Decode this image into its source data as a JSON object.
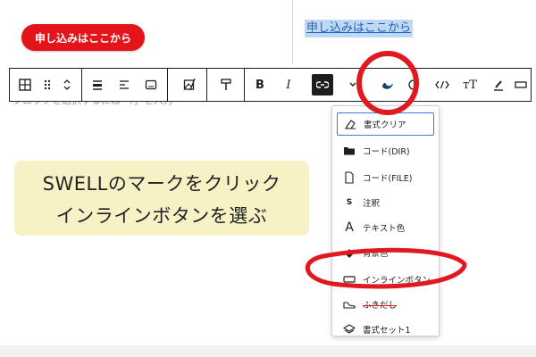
{
  "content": {
    "cta_button_label": "申し込みはここから",
    "link_text": "申し込みはここから",
    "ghost_text": "ブロックを選択するには「/」を入力"
  },
  "toolbar": {
    "items": [
      "table-icon",
      "drag-handle-icon",
      "move-up-down-icon",
      "align-icon",
      "text-align-icon",
      "block-icon",
      "image-icon",
      "bold",
      "italic",
      "link-icon",
      "more-chevron-icon",
      "swell-icon",
      "circle-icon",
      "code-icon",
      "font-size-icon",
      "highlight-icon",
      "box-icon"
    ],
    "bold_label": "B",
    "italic_label": "I",
    "font_size_label": "тT"
  },
  "annotation": {
    "line1": "SWELLのマークをクリック",
    "line2": "インラインボタンを選ぶ",
    "background_color": "#f7f1c5",
    "circle_color": "#e0181f"
  },
  "dropdown": {
    "items": [
      {
        "label": "書式クリア",
        "icon": "eraser-icon"
      },
      {
        "label": "コード(DIR)",
        "icon": "folder-icon"
      },
      {
        "label": "コード(FILE)",
        "icon": "file-icon"
      },
      {
        "label": "注釈",
        "icon": "s-icon"
      },
      {
        "label": "テキスト色",
        "icon": "text-a-icon"
      },
      {
        "label": "背景色",
        "icon": "paint-bucket-icon"
      },
      {
        "label": "インラインボタン",
        "icon": "inline-button-icon"
      },
      {
        "label": "ふきだし",
        "icon": "shoe-icon"
      },
      {
        "label": "書式セット1",
        "icon": "layers-icon"
      }
    ]
  },
  "colors": {
    "accent_red": "#e5141b",
    "link_highlight": "#bfd9f5",
    "selection_border": "#3a7be0"
  }
}
